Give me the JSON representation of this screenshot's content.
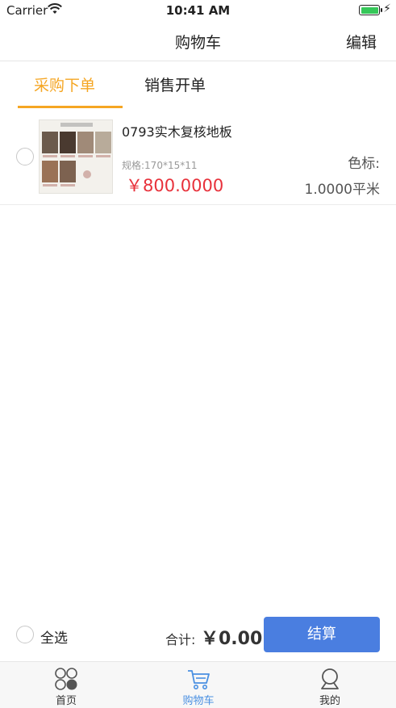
{
  "status_bar": {
    "carrier": "Carrier",
    "time": "10:41 AM",
    "battery_color": "#35c759"
  },
  "nav": {
    "title": "购物车",
    "edit_label": "编辑"
  },
  "tabs": [
    {
      "label": "采购下单",
      "active": true
    },
    {
      "label": "销售开单",
      "active": false
    }
  ],
  "accent_color": "#f5a623",
  "cart_items": [
    {
      "name": "0793实木复核地板",
      "spec": "规格:170*15*11",
      "price": "￥800.0000",
      "color_label": "色标:",
      "quantity": "1.0000平米",
      "price_color": "#e8313b"
    }
  ],
  "footer": {
    "select_all_label": "全选",
    "total_label": "合计:",
    "total_value": "￥0.00",
    "checkout_label": "结算",
    "checkout_color": "#4a7ee0"
  },
  "tabbar": [
    {
      "label": "首页",
      "icon": "home-grid-icon",
      "active": false
    },
    {
      "label": "购物车",
      "icon": "cart-icon",
      "active": true
    },
    {
      "label": "我的",
      "icon": "profile-icon",
      "active": false
    }
  ]
}
